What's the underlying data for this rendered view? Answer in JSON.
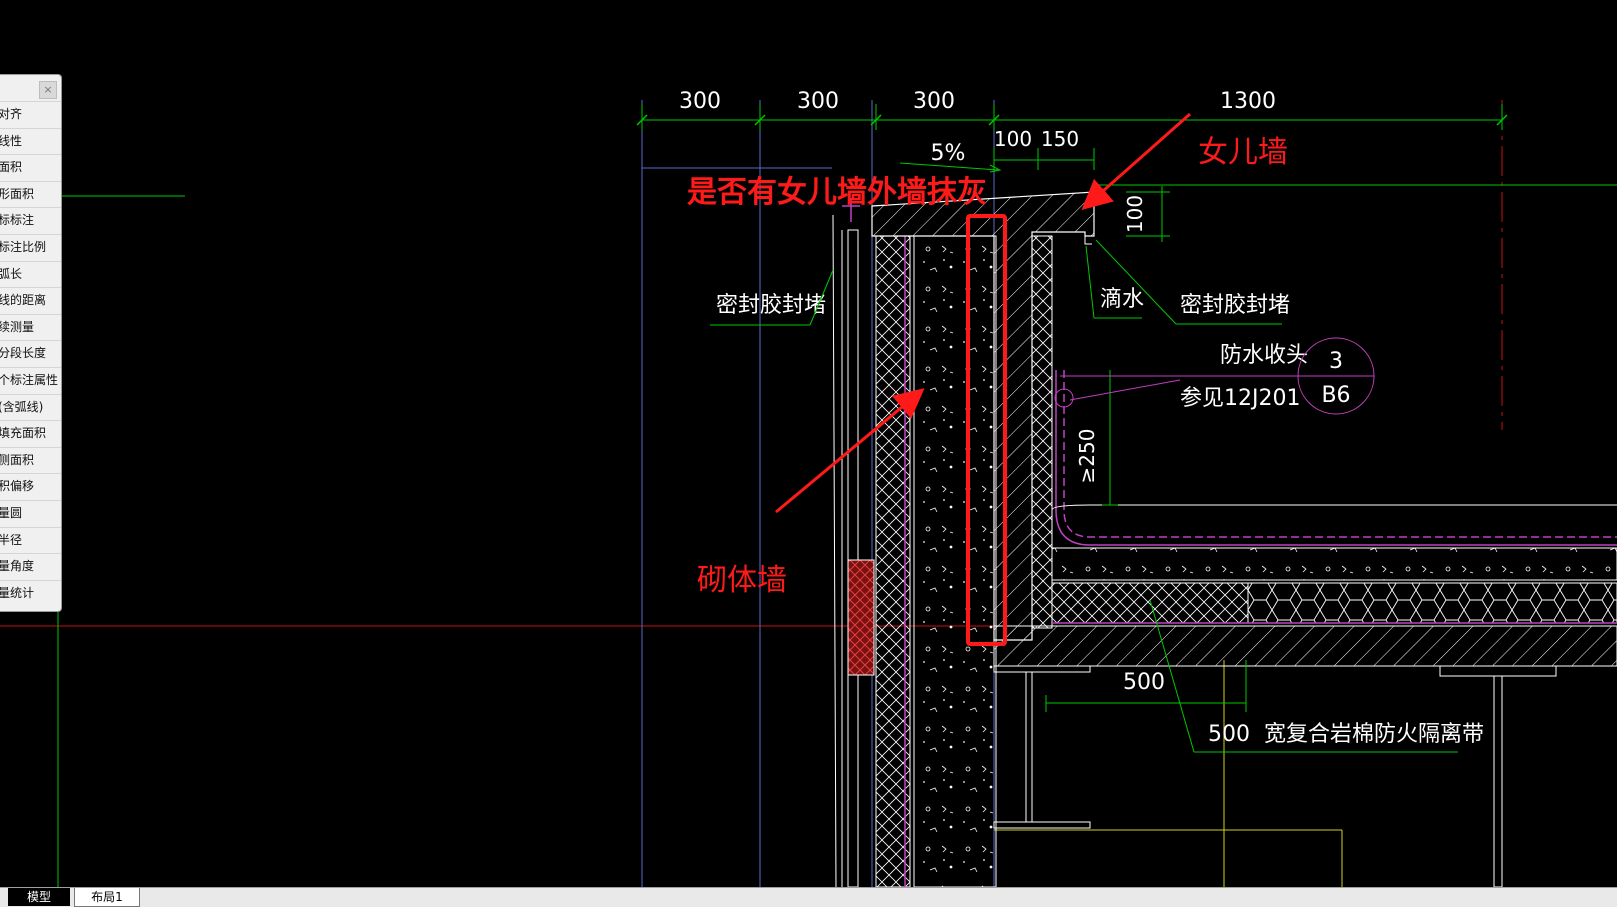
{
  "side_panel": {
    "close_label": "×",
    "items": [
      "对齐",
      "线性",
      "面积",
      "形面积",
      "标标注",
      "标注比例",
      "弧长",
      "线的距离",
      "续测量",
      "分段长度",
      "个标注属性",
      "(含弧线)",
      "填充面积",
      "侧面积",
      "积偏移",
      "量圆",
      "半径",
      "量角度",
      "量统计"
    ]
  },
  "drawing": {
    "dimensions": {
      "top_300_a": "300",
      "top_300_b": "300",
      "top_300_c": "300",
      "top_1300": "1300",
      "slope": "5%",
      "d_100": "100",
      "d_150": "150",
      "d_100_vertical": "100",
      "d_250_vertical": "≥250",
      "d_500_a": "500",
      "d_500_b": "500"
    },
    "notes": {
      "sealant_left": "密封胶封堵",
      "sealant_right": "密封胶封堵",
      "drip": "滴水",
      "waterproof_end": "防水收头",
      "reference": "参见12J201",
      "fire_band": "宽复合岩棉防火隔离带",
      "detail_number": "3",
      "detail_sheet": "B6"
    },
    "annotations": {
      "question": "是否有女儿墙外墙抹灰",
      "parapet": "女儿墙",
      "masonry_wall": "砌体墙"
    },
    "colors": {
      "annotation_red": "#ff1a1a",
      "leader_green": "#00c800",
      "outline_white": "#ffffff",
      "magenta": "#c040c0",
      "grid_blue": "#5a6ac8"
    }
  },
  "tabs": {
    "model": "模型",
    "layout1": "布局1"
  }
}
